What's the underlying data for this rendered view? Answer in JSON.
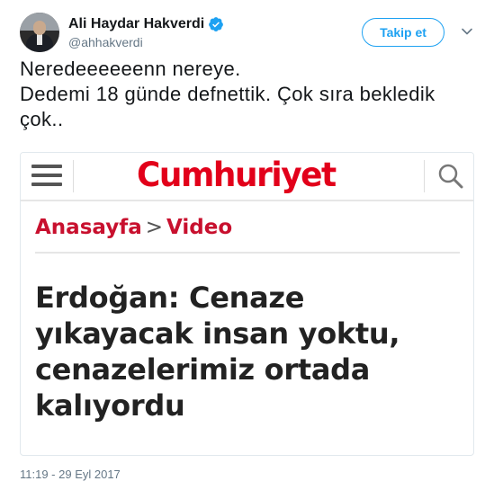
{
  "user": {
    "display_name": "Ali Haydar Hakverdi",
    "handle": "@ahhakverdi",
    "verified": true
  },
  "actions": {
    "follow_label": "Takip et",
    "menu_icon": "chevron-down-icon"
  },
  "tweet": {
    "lines": [
      "Neredeeeeeenn nereye.",
      "Dedemi 18 günde defnettik. Çok sıra bekledik",
      "çok.."
    ],
    "timestamp": "11:19 - 29 Eyl 2017"
  },
  "media": {
    "logo": "Cumhuriyet",
    "breadcrumb": [
      "Anasayfa",
      ">",
      "Video"
    ],
    "headline_lines": [
      "Erdoğan: Cenaze",
      "yıkayacak insan yoktu,",
      "cenazelerimiz ortada",
      "kalıyordu"
    ],
    "icons": [
      "hamburger-menu-icon",
      "search-icon"
    ]
  },
  "colors": {
    "accent": "#1da1f2",
    "brand_red": "#e2001a",
    "text": "#14171a",
    "muted": "#657786"
  }
}
